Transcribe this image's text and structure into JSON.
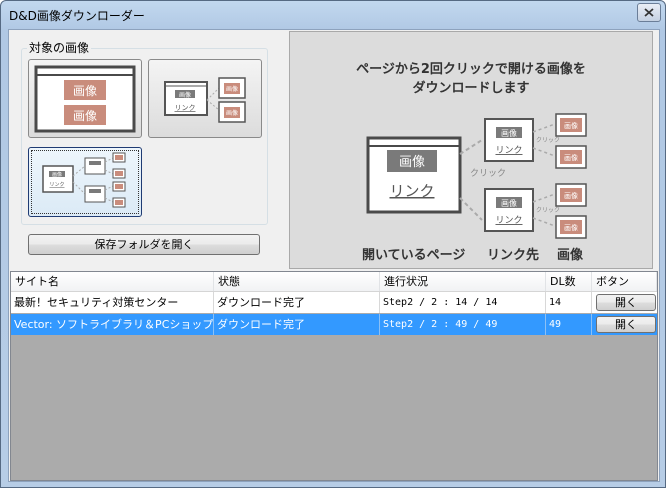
{
  "window": {
    "title": "D&D画像ダウンローダー"
  },
  "group": {
    "label": "対象の画像"
  },
  "thumb": {
    "image": "画像",
    "link": "リンク",
    "click": "クリック"
  },
  "open_folder_button": "保存フォルダを開く",
  "preview": {
    "line1": "ページから2回クリックで開ける画像を",
    "line2": "ダウンロードします",
    "img_label": "画像",
    "link_label": "リンク",
    "click_label": "クリック",
    "caption_page": "開いているページ",
    "caption_link": "リンク先",
    "caption_image": "画像"
  },
  "table": {
    "columns": [
      "サイト名",
      "状態",
      "進行状況",
      "DL数",
      "ボタン"
    ],
    "rows": [
      {
        "site": "最新！セキュリティ対策センター",
        "status": "ダウンロード完了",
        "progress": "Step2 / 2 : 14 / 14",
        "count": "14",
        "button": "開く",
        "selected": false
      },
      {
        "site": "Vector: ソフトライブラリ＆PCショップ - ...",
        "status": "ダウンロード完了",
        "progress": "Step2 / 2 : 49 / 49",
        "count": "49",
        "button": "開く",
        "selected": true
      }
    ]
  },
  "colors": {
    "accent_red": "#c98c7c",
    "selection": "#3399ff",
    "title_bar": "#c2d8ef"
  }
}
